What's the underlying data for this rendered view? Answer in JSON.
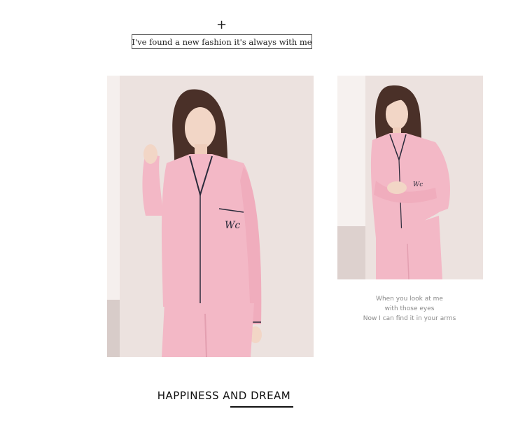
{
  "header": {
    "plus_symbol": "+",
    "tagline": "I've found a new fashion it's always with me"
  },
  "images": {
    "main_photo": {
      "subject": "woman in pink pajamas",
      "accent": "#f3b8c6"
    },
    "side_photo": {
      "subject": "woman in pink pajamas",
      "accent": "#f3b8c6"
    }
  },
  "caption": {
    "lines": [
      "When you look at me",
      "with those eyes",
      "Now I can find it in your arms"
    ]
  },
  "footer": {
    "headline": "HAPPINESS AND DREAM"
  },
  "colors": {
    "background": "#ffffff",
    "wall": "#e8ddda",
    "pajama_pink": "#f3b8c6",
    "piping": "#2a2a3a",
    "hair": "#4a3028",
    "skin": "#f2d6c6"
  }
}
